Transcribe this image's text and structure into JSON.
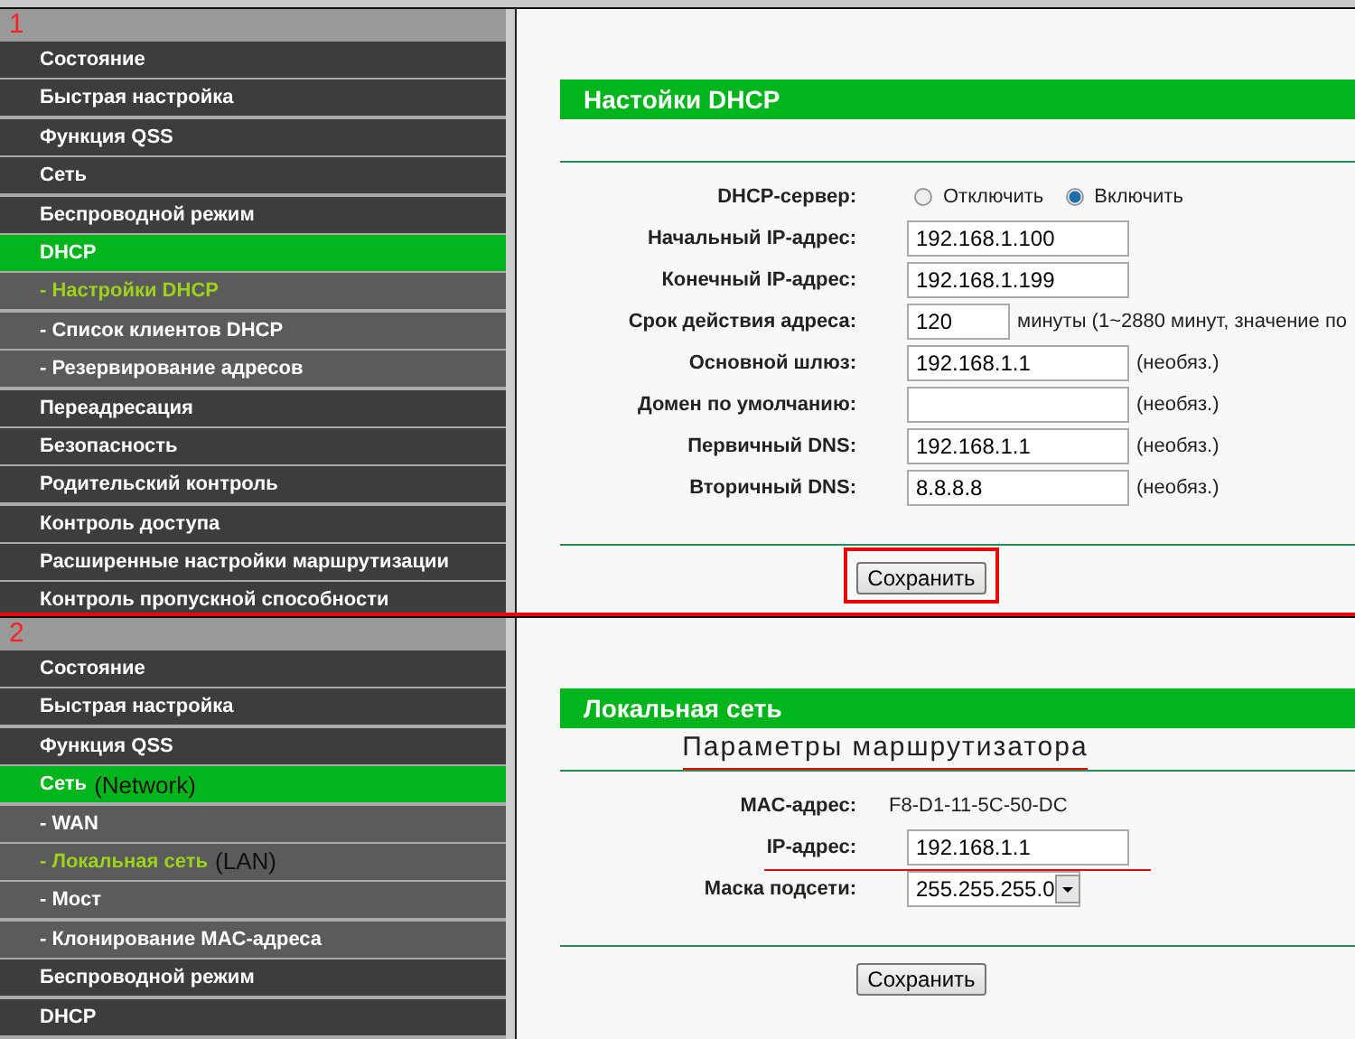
{
  "panels": [
    {
      "marker": "1",
      "menu": [
        {
          "label": "Состояние",
          "kind": "main",
          "selected": false
        },
        {
          "label": "Быстрая настройка",
          "kind": "main",
          "selected": false
        },
        {
          "label": "Функция QSS",
          "kind": "main",
          "selected": false
        },
        {
          "label": "Сеть",
          "kind": "main",
          "selected": false
        },
        {
          "label": "Беспроводной режим",
          "kind": "main",
          "selected": false
        },
        {
          "label": "DHCP",
          "kind": "main",
          "selected": true
        },
        {
          "label": "- Настройки DHCP",
          "kind": "sub",
          "selected": true
        },
        {
          "label": "- Список клиентов DHCP",
          "kind": "sub",
          "selected": false
        },
        {
          "label": "- Резервирование адресов",
          "kind": "sub",
          "selected": false
        },
        {
          "label": "Переадресация",
          "kind": "main",
          "selected": false
        },
        {
          "label": "Безопасность",
          "kind": "main",
          "selected": false
        },
        {
          "label": "Родительский контроль",
          "kind": "main",
          "selected": false
        },
        {
          "label": "Контроль доступа",
          "kind": "main",
          "selected": false
        },
        {
          "label": "Расширенные настройки маршрутизации",
          "kind": "main",
          "selected": false
        },
        {
          "label": "Контроль пропускной способности",
          "kind": "main",
          "selected": false
        }
      ],
      "title": "Настойки DHCP",
      "fields": [
        {
          "label": "DHCP-сервер:",
          "kind": "radio",
          "options": [
            {
              "label": "Отключить",
              "selected": false
            },
            {
              "label": "Включить",
              "selected": true
            }
          ]
        },
        {
          "label": "Начальный IP-адрес:",
          "kind": "input",
          "value": "192.168.1.100"
        },
        {
          "label": "Конечный IP-адрес:",
          "kind": "input",
          "value": "192.168.1.199"
        },
        {
          "label": "Срок действия адреса:",
          "kind": "number",
          "value": "120",
          "suffix": "минуты (1~2880 минут, значение по"
        },
        {
          "label": "Основной шлюз:",
          "kind": "input",
          "value": "192.168.1.1",
          "suffix": "(необяз.)"
        },
        {
          "label": "Домен по умолчанию:",
          "kind": "input",
          "suffix": "(необяз.)"
        },
        {
          "label": "Первичный DNS:",
          "kind": "input",
          "value": "192.168.1.1",
          "suffix": "(необяз.)"
        },
        {
          "label": "Вторичный DNS:",
          "kind": "input",
          "value": "8.8.8.8",
          "suffix": "(необяз.)"
        }
      ],
      "save": {
        "label": "Сохранить",
        "highlighted": true
      }
    },
    {
      "marker": "2",
      "menu": [
        {
          "label": "Состояние",
          "kind": "main",
          "selected": false
        },
        {
          "label": "Быстрая настройка",
          "kind": "main",
          "selected": false
        },
        {
          "label": "Функция QSS",
          "kind": "main",
          "selected": false
        },
        {
          "label": "Сеть",
          "kind": "main",
          "selected": true,
          "note": "(Network)"
        },
        {
          "label": "- WAN",
          "kind": "sub",
          "selected": false
        },
        {
          "label": "- Локальная сеть",
          "kind": "sub",
          "selected": true,
          "note": "(LAN)"
        },
        {
          "label": "- Мост",
          "kind": "sub",
          "selected": false
        },
        {
          "label": "- Клонирование MAC-адреса",
          "kind": "sub",
          "selected": false
        },
        {
          "label": "Беспроводной режим",
          "kind": "main",
          "selected": false
        },
        {
          "label": "DHCP",
          "kind": "main",
          "selected": false
        }
      ],
      "title": "Локальная сеть",
      "subtitle": "Параметры маршрутизатора",
      "fields": [
        {
          "label": "MAC-адрес:",
          "kind": "text",
          "value": "F8-D1-11-5C-50-DC"
        },
        {
          "label": "IP-адрес:",
          "kind": "input",
          "value": "192.168.1.1",
          "underlined": true
        },
        {
          "label": "Маска подсети:",
          "kind": "select",
          "value": "255.255.255.0"
        }
      ],
      "save": {
        "label": "Сохранить"
      }
    }
  ]
}
